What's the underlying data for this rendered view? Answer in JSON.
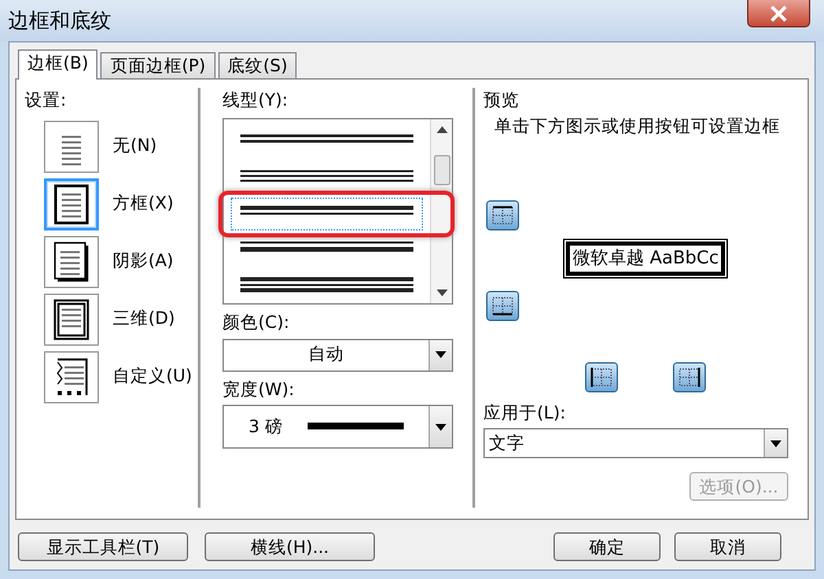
{
  "window": {
    "title": "边框和底纹"
  },
  "tabs": [
    {
      "label": "边框(B)",
      "selected": true
    },
    {
      "label": "页面边框(P)",
      "selected": false
    },
    {
      "label": "底纹(S)",
      "selected": false
    }
  ],
  "settings": {
    "label": "设置:",
    "items": [
      {
        "kind": "none",
        "label": "无(N)",
        "selected": false
      },
      {
        "kind": "box",
        "label": "方框(X)",
        "selected": true
      },
      {
        "kind": "shadow",
        "label": "阴影(A)",
        "selected": false
      },
      {
        "kind": "threed",
        "label": "三维(D)",
        "selected": false
      },
      {
        "kind": "custom",
        "label": "自定义(U)",
        "selected": false
      }
    ]
  },
  "line_style": {
    "label": "线型(Y):",
    "items": [
      {
        "kind": "double",
        "selected": false,
        "highlighted": false
      },
      {
        "kind": "triple",
        "selected": false,
        "highlighted": false
      },
      {
        "kind": "thick-thin",
        "selected": true,
        "highlighted": true
      },
      {
        "kind": "thin-thick",
        "selected": false,
        "highlighted": false
      },
      {
        "kind": "thick-double",
        "selected": false,
        "highlighted": false
      }
    ]
  },
  "color": {
    "label": "颜色(C):",
    "value": "自动"
  },
  "width": {
    "label": "宽度(W):",
    "value": "3 磅"
  },
  "preview": {
    "label": "预览",
    "hint": "单击下方图示或使用按钮可设置边框",
    "sample": "微软卓越 AaBbCc",
    "buttons": [
      {
        "kind": "top"
      },
      {
        "kind": "bottom"
      },
      {
        "kind": "left"
      },
      {
        "kind": "right"
      }
    ]
  },
  "apply_to": {
    "label": "应用于(L):",
    "value": "文字"
  },
  "options_button": {
    "label": "选项(O)...",
    "disabled": true
  },
  "footer_buttons": [
    {
      "label": "显示工具栏(T)"
    },
    {
      "label": "横线(H)..."
    },
    {
      "label": "确定"
    },
    {
      "label": "取消"
    }
  ]
}
